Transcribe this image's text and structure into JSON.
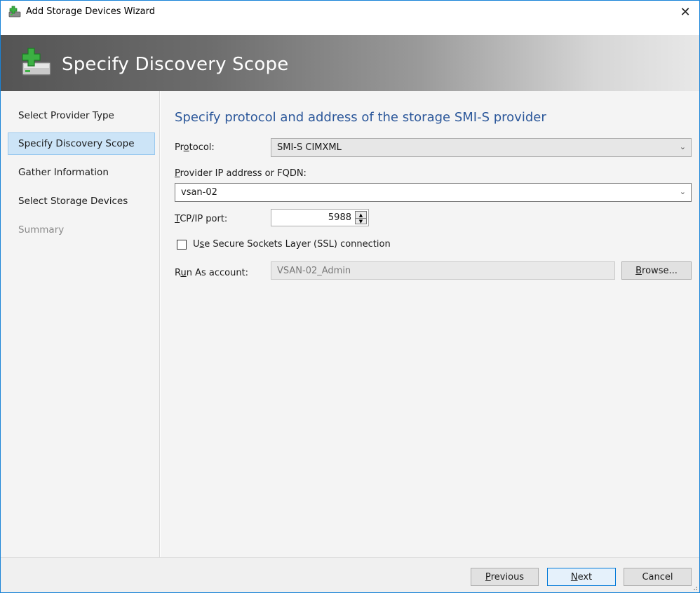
{
  "window": {
    "title": "Add Storage Devices Wizard",
    "close_glyph": "✕"
  },
  "banner": {
    "title": "Specify Discovery Scope",
    "icon": "add-storage-icon"
  },
  "sidebar": {
    "items": [
      {
        "label": "Select Provider Type",
        "state": "normal"
      },
      {
        "label": "Specify Discovery Scope",
        "state": "active"
      },
      {
        "label": "Gather Information",
        "state": "normal"
      },
      {
        "label": "Select Storage Devices",
        "state": "normal"
      },
      {
        "label": "Summary",
        "state": "disabled"
      }
    ]
  },
  "main": {
    "heading": "Specify protocol and address of the storage SMI-S provider",
    "protocol": {
      "label_pre": "Pr",
      "label_key": "o",
      "label_post": "tocol:",
      "value": "SMI-S CIMXML"
    },
    "provider": {
      "label_pre": "",
      "label_key": "P",
      "label_post": "rovider IP address or FQDN:",
      "value": "vsan-02"
    },
    "port": {
      "label_pre": "",
      "label_key": "T",
      "label_post": "CP/IP port:",
      "value": "5988"
    },
    "ssl": {
      "label_pre": "U",
      "label_key": "s",
      "label_post": "e Secure Sockets Layer (SSL) connection",
      "checked": false
    },
    "run_as": {
      "label_pre": "R",
      "label_key": "u",
      "label_post": "n As account:",
      "value": "VSAN-02_Admin",
      "browse_key": "B",
      "browse_post": "rowse..."
    }
  },
  "footer": {
    "previous_key": "P",
    "previous_post": "revious",
    "next_key": "N",
    "next_post": "ext",
    "cancel": "Cancel"
  },
  "colors": {
    "accent": "#2b579a",
    "selection": "#cce4f7",
    "window_border": "#1883d7"
  }
}
